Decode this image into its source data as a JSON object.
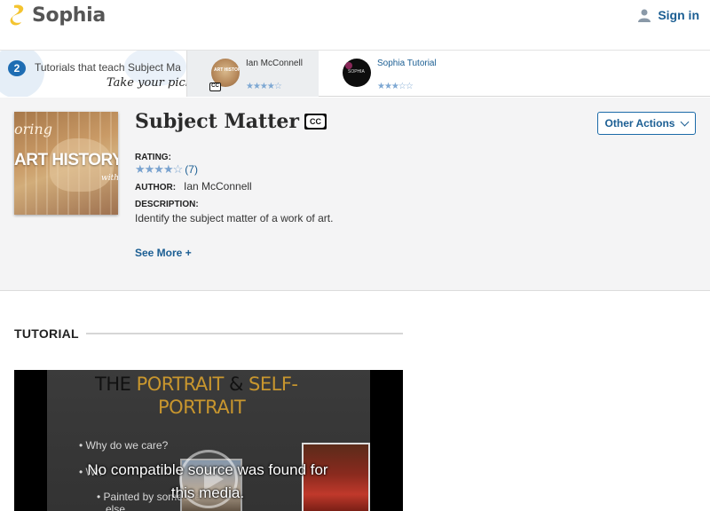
{
  "header": {
    "brand": "Sophia",
    "brand_color": "#f4c430",
    "signin_label": "Sign in",
    "signin_icon": "person-icon"
  },
  "tutorial_bar": {
    "count": "2",
    "title": "Tutorials that teach Subject Matter",
    "prompt": "Take your pick:",
    "cards": [
      {
        "author": "Ian McConnell",
        "rating": 4,
        "stars": "★★★★☆",
        "active": true,
        "captioned": true,
        "thumb": "art-history-thumbnail"
      },
      {
        "author": "Sophia Tutorial",
        "rating": 3,
        "stars": "★★★☆☆",
        "active": false,
        "captioned": false,
        "thumb": "sophia-thumbnail"
      }
    ]
  },
  "summary": {
    "title": "Subject Matter",
    "cc_label": "CC",
    "cover": {
      "line1": "oring",
      "line2": "ART HISTORY",
      "line3": "with"
    },
    "rating_label": "RATING:",
    "rating_stars": "★★★★☆",
    "rating_value": 4,
    "rating_count": "(7)",
    "author_label": "AUTHOR:",
    "author": "Ian McConnell",
    "description_label": "DESCRIPTION:",
    "description": "Identify the subject matter of a work of art.",
    "see_more": "See More +",
    "other_actions": "Other Actions"
  },
  "tutorial_section": {
    "heading": "TUTORIAL",
    "video": {
      "slide_title_part1": "THE ",
      "slide_title_part2": "PORTRAIT",
      "slide_title_part3": " & ",
      "slide_title_part4": "SELF-",
      "slide_title_line2": "PORTRAIT",
      "bullet1": "• Why do we care?",
      "bullet2": "• Wh",
      "bullet3": "• Painted by someone",
      "bullet4": "else",
      "error": "No compatible source was found for this media."
    }
  },
  "colors": {
    "link": "#1b5e93",
    "badge": "#1e6db3",
    "star": "#7aa3cf",
    "accent_gold": "#c8962e"
  }
}
